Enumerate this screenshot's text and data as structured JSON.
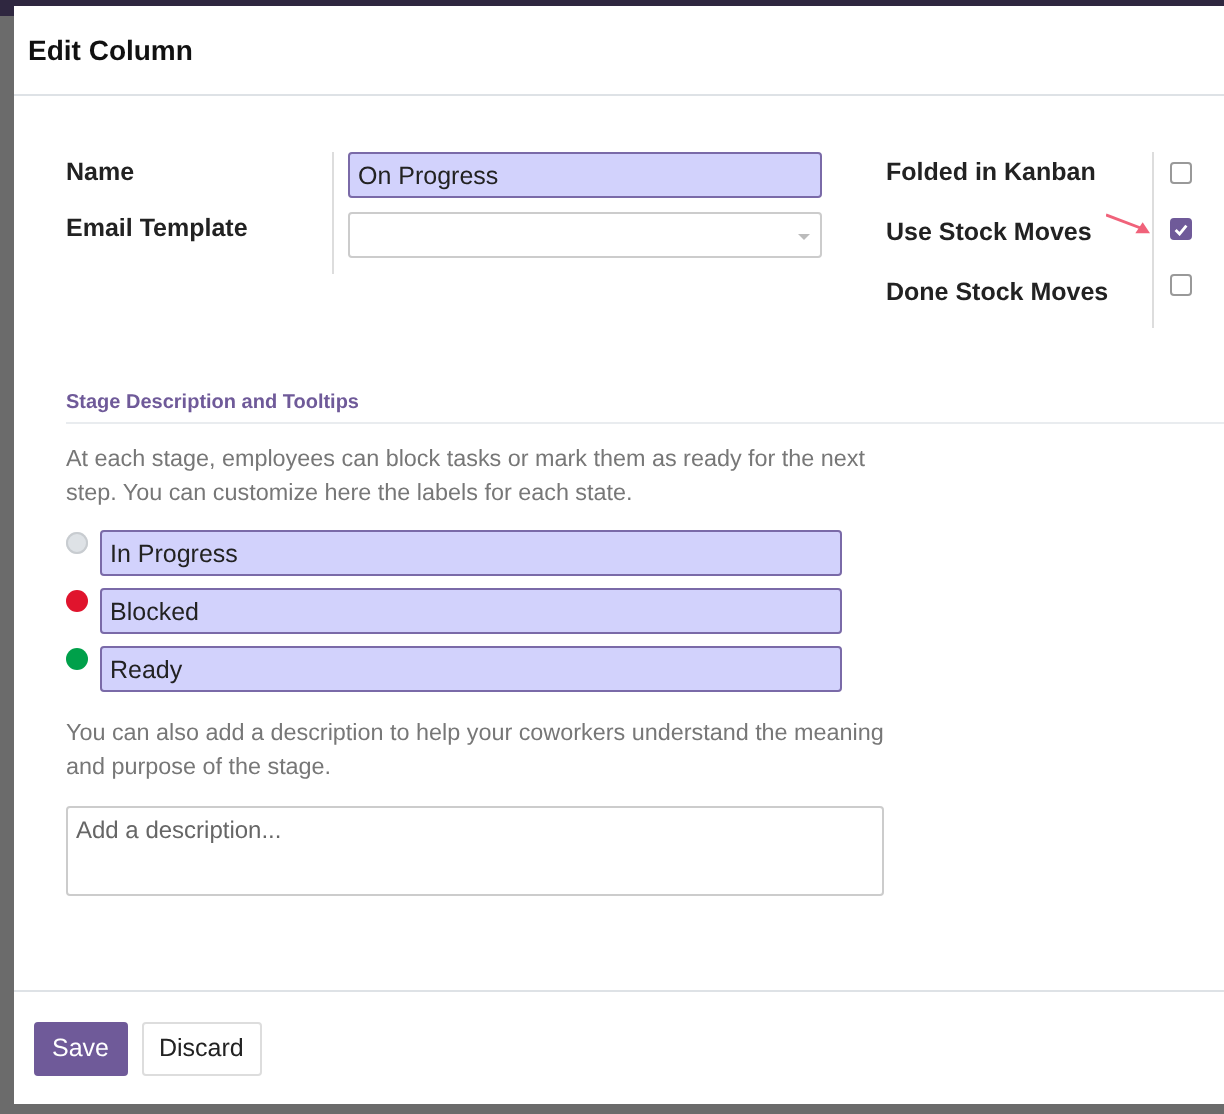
{
  "dialog": {
    "title": "Edit Column",
    "fields": [
      {
        "label": "Name",
        "kind": "text",
        "value": "On Progress"
      },
      {
        "label": "Email Template",
        "kind": "select"
      }
    ],
    "options": [
      {
        "label": "Folded in Kanban",
        "checked": false
      },
      {
        "label": "Use Stock Moves",
        "checked": true
      },
      {
        "label": "Done Stock Moves",
        "checked": false
      }
    ],
    "section": {
      "title": "Stage Description and Tooltips",
      "intro": "At each stage, employees can block tasks or mark them as ready for the next step. You can customize here the labels for each state.",
      "states": [
        {
          "value": "In Progress",
          "color": "#dee2e6"
        },
        {
          "value": "Blocked",
          "color": "#e0142d"
        },
        {
          "value": "Ready",
          "color": "#00a04a"
        }
      ],
      "hint": "You can also add a description to help your coworkers understand the meaning and purpose of the stage.",
      "description": {
        "placeholder": "Add a description..."
      }
    },
    "buttons": [
      {
        "label": "Save",
        "kind": "primary"
      },
      {
        "label": "Discard",
        "kind": "secondary"
      }
    ]
  }
}
